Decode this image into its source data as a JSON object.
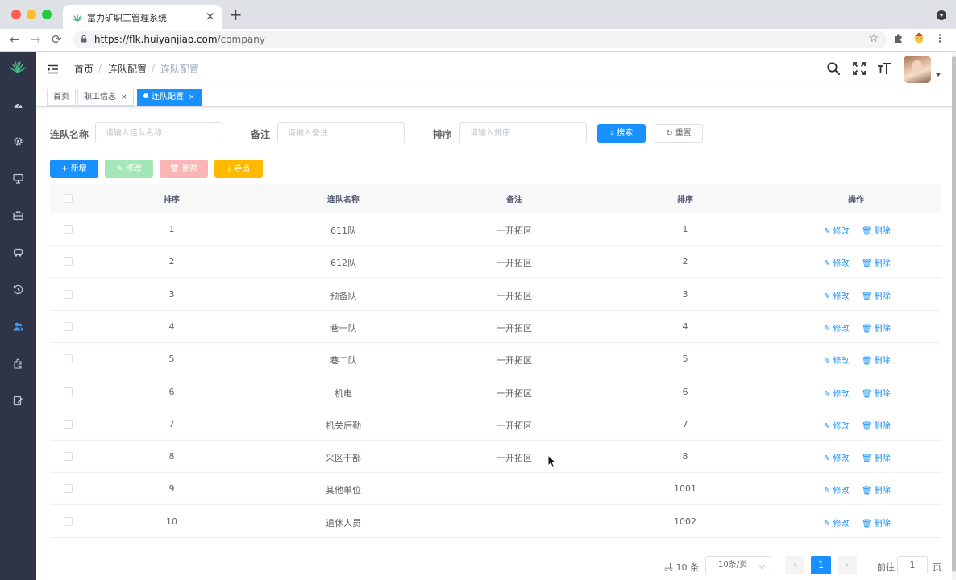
{
  "browser": {
    "tab_title": "富力矿职工管理系统",
    "tab_close": "×",
    "new_tab": "+",
    "url_host": "https://flk.huiyanjiao.com",
    "url_path": "/company",
    "back": "←",
    "forward": "→",
    "reload": "⟳",
    "star": "☆"
  },
  "breadcrumb": [
    "首页",
    "连队配置",
    "连队配置"
  ],
  "breadcrumb_sep": "/",
  "tags": [
    {
      "label": "首页",
      "close": ""
    },
    {
      "label": "职工信息",
      "close": "×"
    },
    {
      "label": "连队配置",
      "close": "×"
    }
  ],
  "search": {
    "name_label": "连队名称",
    "name_placeholder": "请输入连队名称",
    "remark_label": "备注",
    "remark_placeholder": "请输入备注",
    "sort_label": "排序",
    "sort_placeholder": "请输入排序",
    "search_btn": "搜索",
    "reset_btn": "重置"
  },
  "toolbar": {
    "add": "新增",
    "edit": "修改",
    "delete": "删除",
    "export": "导出"
  },
  "table": {
    "columns": [
      "排序",
      "连队名称",
      "备注",
      "排序",
      "操作"
    ],
    "rows": [
      {
        "index": "1",
        "name": "611队",
        "remark": "一开拓区",
        "sort": "1"
      },
      {
        "index": "2",
        "name": "612队",
        "remark": "一开拓区",
        "sort": "2"
      },
      {
        "index": "3",
        "name": "预备队",
        "remark": "一开拓区",
        "sort": "3"
      },
      {
        "index": "4",
        "name": "巷一队",
        "remark": "一开拓区",
        "sort": "4"
      },
      {
        "index": "5",
        "name": "巷二队",
        "remark": "一开拓区",
        "sort": "5"
      },
      {
        "index": "6",
        "name": "机电",
        "remark": "一开拓区",
        "sort": "6"
      },
      {
        "index": "7",
        "name": "机关后勤",
        "remark": "一开拓区",
        "sort": "7"
      },
      {
        "index": "8",
        "name": "采区干部",
        "remark": "一开拓区",
        "sort": "8"
      },
      {
        "index": "9",
        "name": "其他单位",
        "remark": "",
        "sort": "1001"
      },
      {
        "index": "10",
        "name": "退休人员",
        "remark": "",
        "sort": "1002"
      }
    ],
    "row_edit": "修改",
    "row_delete": "删除"
  },
  "pagination": {
    "total": "共 10 条",
    "page_size": "10条/页",
    "prev": "‹",
    "current": "1",
    "next": "›",
    "goto_prefix": "前往",
    "goto_value": "1",
    "goto_suffix": "页"
  },
  "colors": {
    "primary": "#1890ff",
    "sidebar": "#2f3447",
    "success_light": "#a3e6b7",
    "danger_light": "#fab6b6",
    "warning": "#ffba00"
  }
}
